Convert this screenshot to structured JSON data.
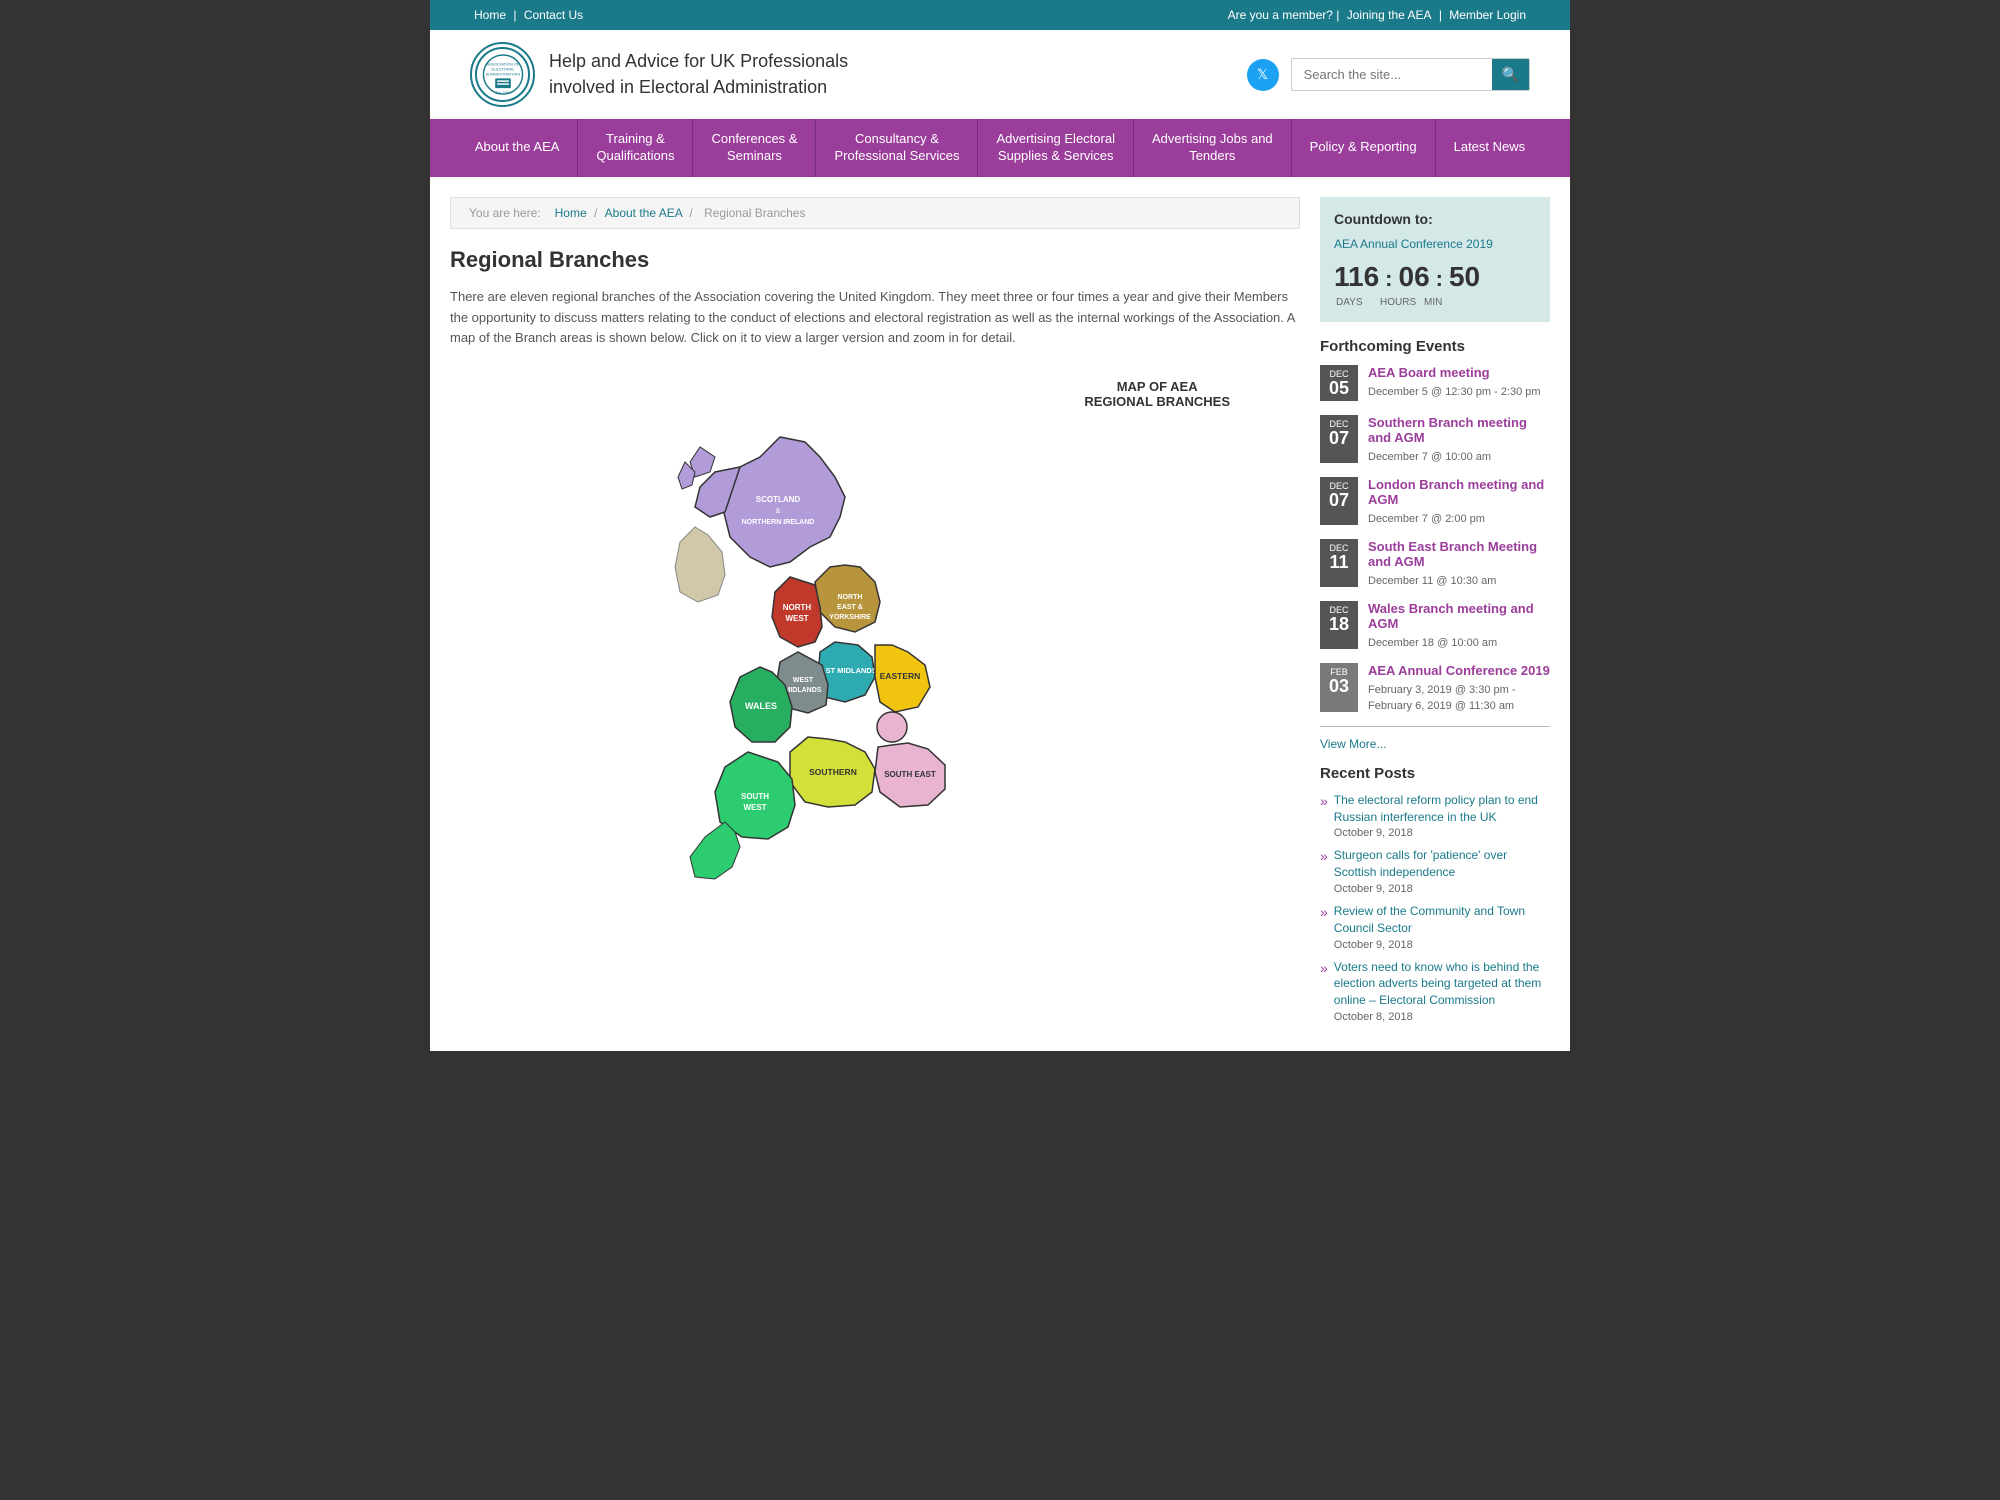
{
  "topbar": {
    "left": [
      {
        "label": "Home",
        "href": "#"
      },
      {
        "label": "Contact Us",
        "href": "#"
      }
    ],
    "right": [
      {
        "label": "Are you a member?"
      },
      {
        "label": "Joining the AEA",
        "href": "#"
      },
      {
        "label": "Member Login",
        "href": "#"
      }
    ]
  },
  "header": {
    "logo_text": "ASSOCIATION OF ELECTORAL ADMINISTRATORS Est. 1987",
    "title_line1": "Help and Advice for UK Professionals",
    "title_line2": "involved in Electoral Administration",
    "search_placeholder": "Search the site...",
    "twitter_label": "Twitter"
  },
  "nav": {
    "items": [
      {
        "label": "About the AEA"
      },
      {
        "label": "Training &\nQualifications"
      },
      {
        "label": "Conferences &\nSeminars"
      },
      {
        "label": "Consultancy &\nProfessional Services"
      },
      {
        "label": "Advertising Electoral\nSupplies & Services"
      },
      {
        "label": "Advertising Jobs and\nTenders"
      },
      {
        "label": "Policy & Reporting"
      },
      {
        "label": "Latest News"
      }
    ]
  },
  "breadcrumb": {
    "prefix": "You are here:",
    "items": [
      {
        "label": "Home",
        "href": "#"
      },
      {
        "label": "About the AEA",
        "href": "#"
      },
      {
        "label": "Regional Branches"
      }
    ]
  },
  "page": {
    "title": "Regional Branches",
    "description": "There are eleven regional branches of the Association covering the United Kingdom. They meet three or four times a year and give their Members the opportunity to discuss matters relating to the conduct of elections and electoral registration as well as the internal workings of the Association. A map of the Branch areas is shown below. Click on it to view a larger version and zoom in for detail."
  },
  "map": {
    "title_line1": "MAP OF AEA",
    "title_line2": "REGIONAL BRANCHES"
  },
  "sidebar": {
    "countdown": {
      "title": "Countdown to:",
      "event_label": "AEA Annual Conference 2019",
      "days": "116",
      "hours": "06",
      "mins": "50",
      "days_label": "DAYS",
      "hours_label": "HOURS",
      "mins_label": "MIN"
    },
    "events": {
      "title": "Forthcoming Events",
      "items": [
        {
          "month": "DEC",
          "day": "05",
          "title": "AEA Board meeting",
          "datetime": "December 5 @ 12:30 pm - 2:30 pm"
        },
        {
          "month": "DEC",
          "day": "07",
          "title": "Southern Branch meeting and AGM",
          "datetime": "December 7 @ 10:00 am"
        },
        {
          "month": "DEC",
          "day": "07",
          "title": "London Branch meeting and AGM",
          "datetime": "December 7 @ 2:00 pm"
        },
        {
          "month": "DEC",
          "day": "11",
          "title": "South East Branch Meeting and AGM",
          "datetime": "December 11 @ 10:30 am"
        },
        {
          "month": "DEC",
          "day": "18",
          "title": "Wales Branch meeting and AGM",
          "datetime": "December 18 @ 10:00 am"
        },
        {
          "month": "FEB",
          "day": "03",
          "title": "AEA Annual Conference 2019",
          "datetime": "February 3, 2019 @ 3:30 pm - February 6, 2019 @ 11:30 am"
        }
      ],
      "view_more": "View More..."
    },
    "recent_posts": {
      "title": "Recent Posts",
      "items": [
        {
          "title": "The electoral reform policy plan to end Russian interference in the UK",
          "date": "October 9, 2018"
        },
        {
          "title": "Sturgeon calls for 'patience' over Scottish independence",
          "date": "October 9, 2018"
        },
        {
          "title": "Review of the Community and Town Council Sector",
          "date": "October 9, 2018"
        },
        {
          "title": "Voters need to know who is behind the election adverts being targeted at them online – Electoral Commission",
          "date": "October 8, 2018"
        }
      ]
    }
  }
}
